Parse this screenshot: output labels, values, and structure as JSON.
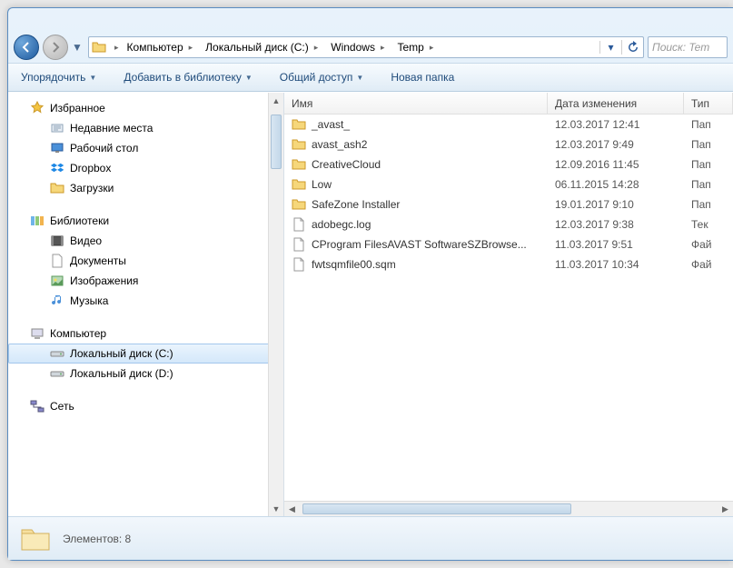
{
  "breadcrumbs": [
    "Компьютер",
    "Локальный диск (C:)",
    "Windows",
    "Temp"
  ],
  "search_placeholder": "Поиск: Tem",
  "toolbar": {
    "organize": "Упорядочить",
    "addlib": "Добавить в библиотеку",
    "share": "Общий доступ",
    "newfolder": "Новая папка"
  },
  "sidebar": {
    "favorites": {
      "head": "Избранное",
      "items": [
        "Недавние места",
        "Рабочий стол",
        "Dropbox",
        "Загрузки"
      ]
    },
    "libraries": {
      "head": "Библиотеки",
      "items": [
        "Видео",
        "Документы",
        "Изображения",
        "Музыка"
      ]
    },
    "computer": {
      "head": "Компьютер",
      "items": [
        "Локальный диск (C:)",
        "Локальный диск (D:)"
      ]
    },
    "network": {
      "head": "Сеть"
    }
  },
  "columns": {
    "name": "Имя",
    "date": "Дата изменения",
    "type": "Тип"
  },
  "files": [
    {
      "icon": "folder",
      "name": "_avast_",
      "date": "12.03.2017 12:41",
      "type": "Пап"
    },
    {
      "icon": "folder",
      "name": "avast_ash2",
      "date": "12.03.2017 9:49",
      "type": "Пап"
    },
    {
      "icon": "folder",
      "name": "CreativeCloud",
      "date": "12.09.2016 11:45",
      "type": "Пап"
    },
    {
      "icon": "folder",
      "name": "Low",
      "date": "06.11.2015 14:28",
      "type": "Пап"
    },
    {
      "icon": "folder",
      "name": "SafeZone Installer",
      "date": "19.01.2017 9:10",
      "type": "Пап"
    },
    {
      "icon": "file",
      "name": "adobegc.log",
      "date": "12.03.2017 9:38",
      "type": "Тек"
    },
    {
      "icon": "file",
      "name": "CProgram FilesAVAST SoftwareSZBrowse...",
      "date": "11.03.2017 9:51",
      "type": "Фай"
    },
    {
      "icon": "file",
      "name": "fwtsqmfile00.sqm",
      "date": "11.03.2017 10:34",
      "type": "Фай"
    }
  ],
  "status": "Элементов: 8"
}
